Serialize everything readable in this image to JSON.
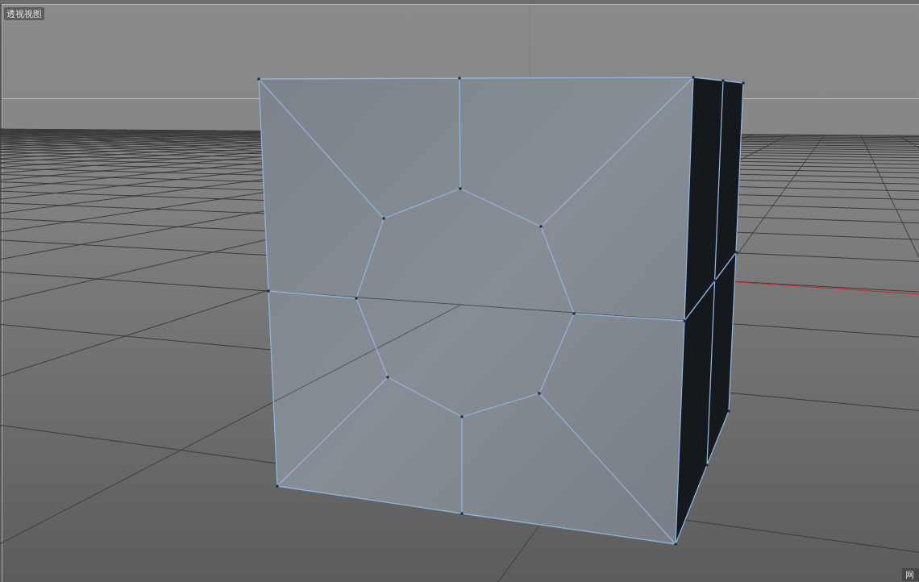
{
  "viewport": {
    "title": "透视视图",
    "corner_label": "网"
  }
}
